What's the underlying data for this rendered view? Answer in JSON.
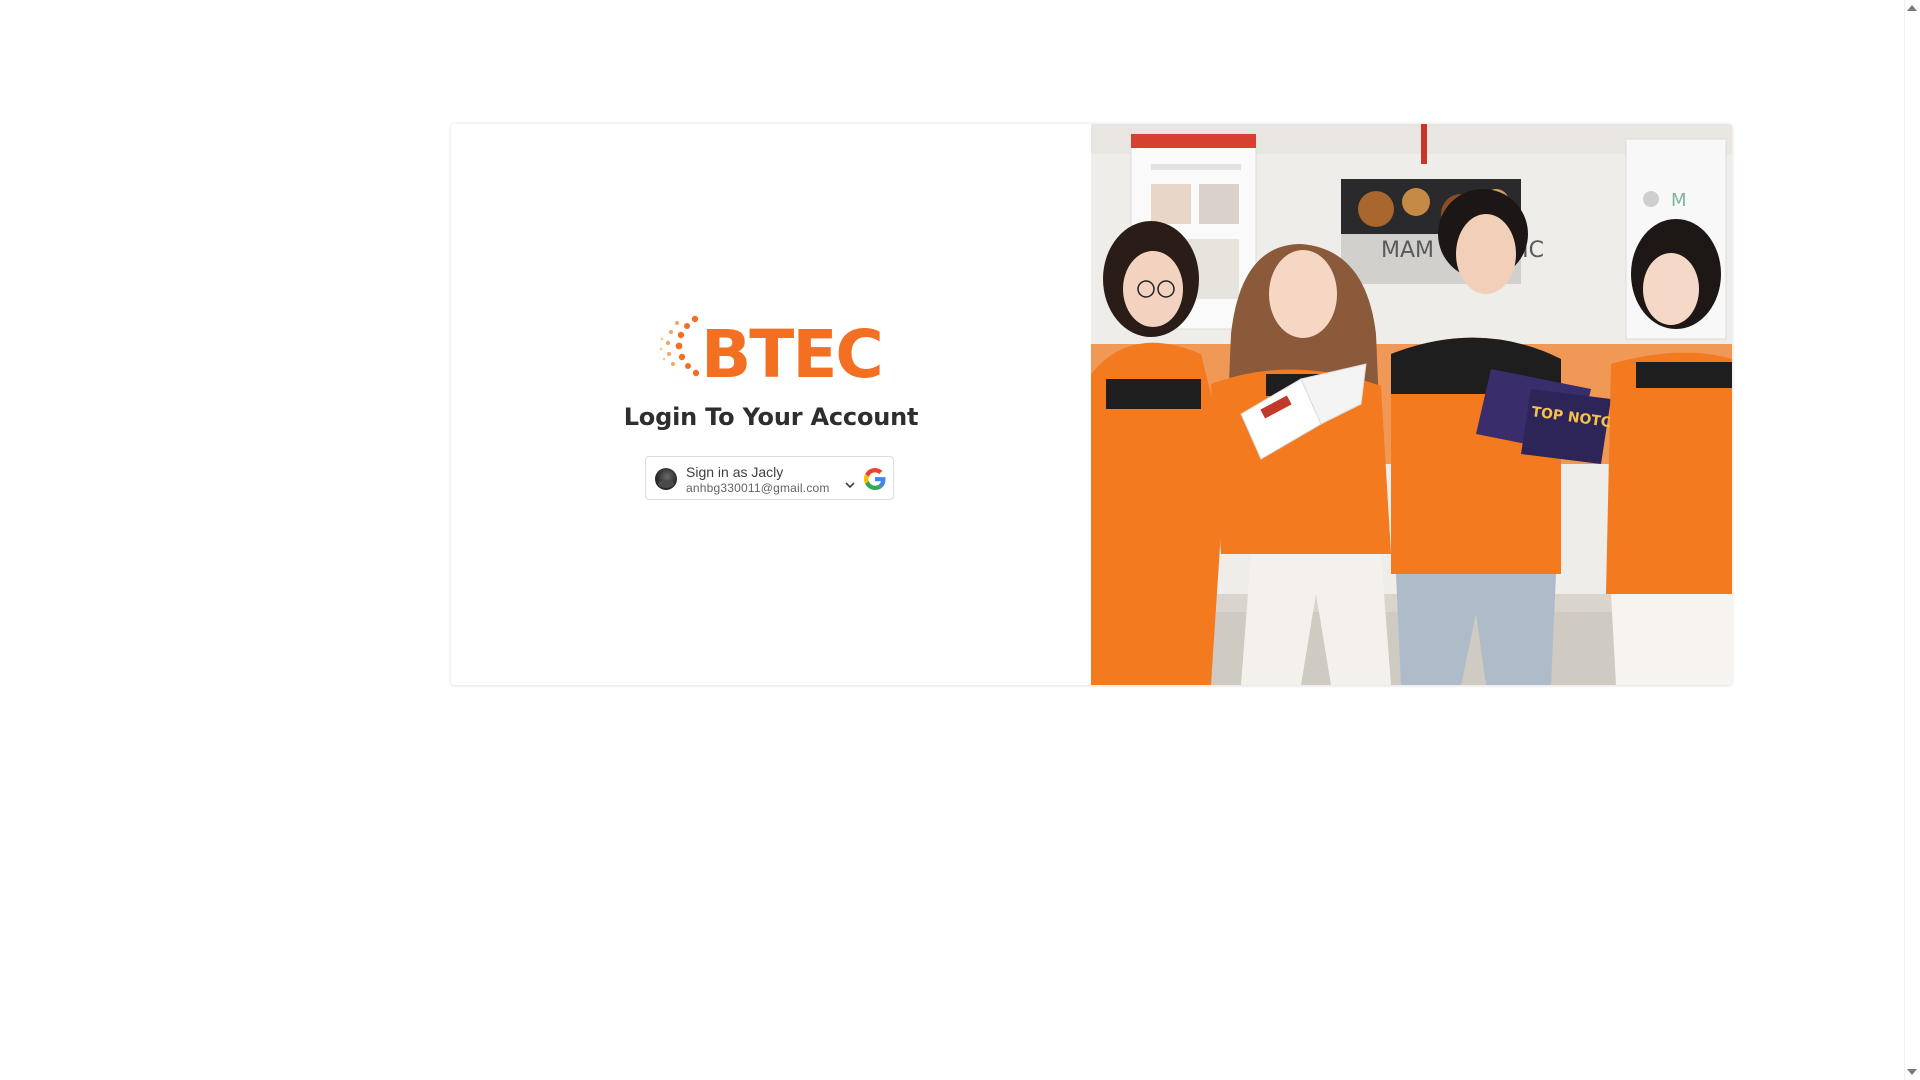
{
  "brand": {
    "logo_text": "BTEC",
    "accent_color": "#f36f21"
  },
  "login": {
    "title": "Login To Your Account"
  },
  "google_signin": {
    "name_label": "Sign in as Jacly",
    "email": "anhbg330011@gmail.com",
    "avatar_icon": "user-avatar",
    "provider_icon": "google-icon",
    "expand_icon": "chevron-down-icon"
  },
  "photo": {
    "description_icon": "students-reading-photo",
    "poster_text": "MAM ORGANIC",
    "magazine_text": "TOP NOTCH",
    "shirt_color": "#f47a20"
  }
}
